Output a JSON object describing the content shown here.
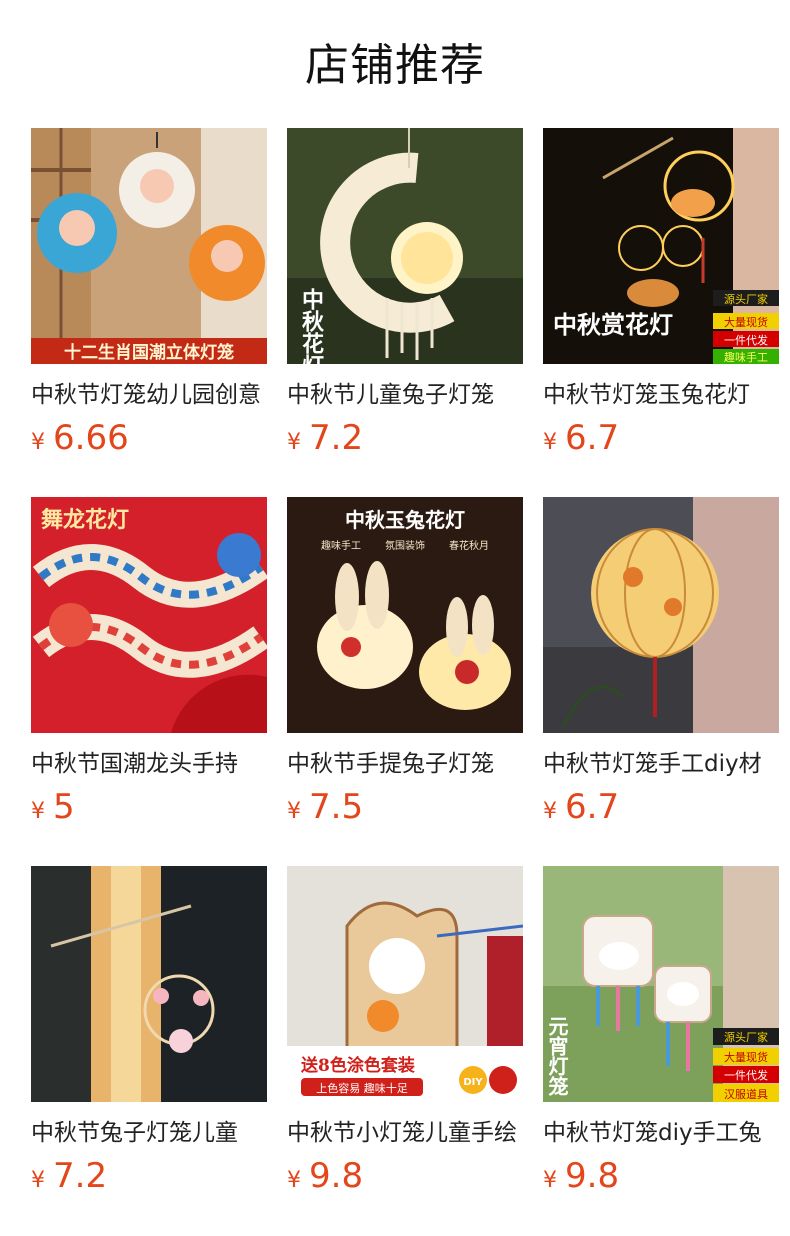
{
  "page_title": "店铺推荐",
  "currency": "¥",
  "products": [
    {
      "title": "中秋节灯笼幼儿园创意",
      "price": "6.66",
      "overlay": "十二生肖国潮立体灯笼"
    },
    {
      "title": "中秋节儿童兔子灯笼",
      "price": "7.2",
      "overlay": "中秋花灯"
    },
    {
      "title": "中秋节灯笼玉兔花灯",
      "price": "6.7",
      "overlay": "中秋赏花灯",
      "tags": [
        "源头厂家",
        "大量现货",
        "一件代发",
        "趣味手工"
      ]
    },
    {
      "title": "中秋节国潮龙头手持",
      "price": "5",
      "overlay": "舞龙花灯"
    },
    {
      "title": "中秋节手提兔子灯笼",
      "price": "7.5",
      "overlay": "中秋玉兔花灯",
      "features": [
        "趣味手工",
        "氛围装饰",
        "春花秋月"
      ]
    },
    {
      "title": "中秋节灯笼手工diy材",
      "price": "6.7"
    },
    {
      "title": "中秋节兔子灯笼儿童",
      "price": "7.2"
    },
    {
      "title": "中秋节小灯笼儿童手绘",
      "price": "9.8",
      "overlay": "送8色涂色套装",
      "subline": "上色容易 趣味十足",
      "badge": "DIY"
    },
    {
      "title": "中秋节灯笼diy手工兔",
      "price": "9.8",
      "overlay": "元宵灯笼",
      "tags": [
        "源头厂家",
        "大量现货",
        "一件代发",
        "汉服道具"
      ]
    }
  ]
}
